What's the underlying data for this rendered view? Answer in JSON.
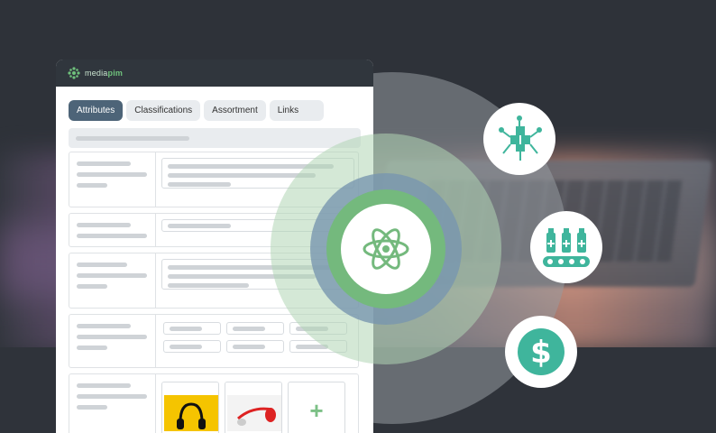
{
  "brand": {
    "logo_prefix": "media",
    "logo_suffix": "pim",
    "accent": "#6fc17c",
    "header_bg": "#30363d"
  },
  "tabs": [
    {
      "label": "Attributes",
      "active": true
    },
    {
      "label": "Classifications",
      "active": false
    },
    {
      "label": "Assortment",
      "active": false
    },
    {
      "label": "Links",
      "active": false
    }
  ],
  "icons": {
    "center": "atom-icon",
    "features": [
      "network-cubes-icon",
      "production-line-icon",
      "dollar-icon"
    ],
    "add": "plus-icon"
  },
  "media": {
    "thumbnails": [
      "yellow-headphones-image",
      "red-headphones-image"
    ],
    "add_label": "+"
  }
}
